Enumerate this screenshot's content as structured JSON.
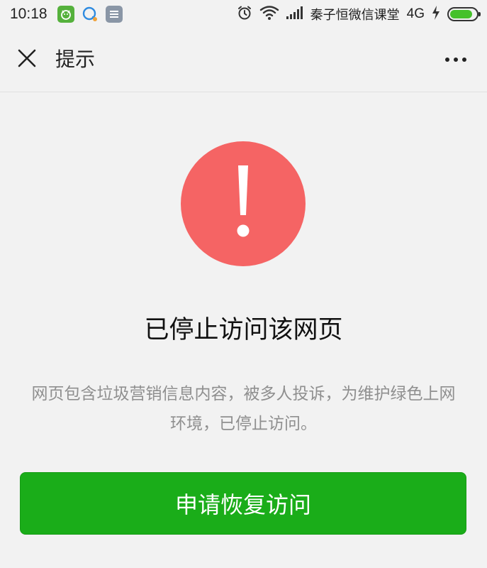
{
  "status_bar": {
    "time": "10:18",
    "carrier": "秦子恒微信课堂",
    "network": "4G",
    "battery_level": 0.85,
    "icons": [
      "alarm-icon",
      "wifi-icon",
      "signal-icon",
      "charging-icon"
    ],
    "app_icons": [
      "wechat-pet-icon",
      "chat-bubble-icon",
      "notes-icon"
    ]
  },
  "title_bar": {
    "title": "提示",
    "close_icon": "close-icon",
    "more_icon": "more-icon"
  },
  "main": {
    "warning_icon": "exclamation-icon",
    "headline": "已停止访问该网页",
    "description": "网页包含垃圾营销信息内容，被多人投诉，为维护绿色上网环境，已停止访问。",
    "primary_button_label": "申请恢复访问"
  },
  "colors": {
    "background": "#f2f2f2",
    "warning": "#f56464",
    "primary": "#1aad19",
    "muted_text": "#8f8f8f"
  }
}
